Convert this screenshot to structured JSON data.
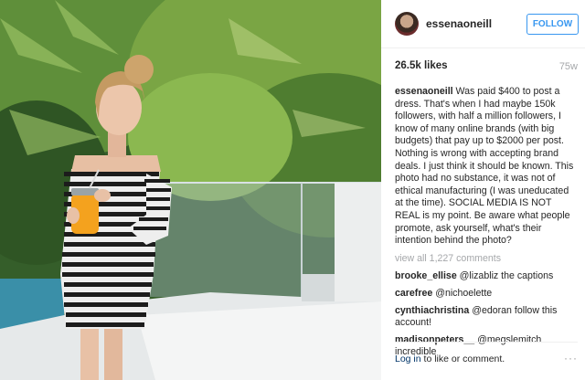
{
  "post": {
    "username": "essenaoneill",
    "follow_label": "FOLLOW",
    "likes": "26.5k likes",
    "age": "75w",
    "caption_user": "essenaoneill",
    "caption_text": "Was paid $400 to post a dress. That's when I had maybe 150k followers, with half a million followers, I know of many online brands (with big budgets) that pay up to $2000 per post. Nothing is wrong with accepting brand deals. I just think it should be known. This photo had no substance, it was not of ethical manufacturing (I was uneducated at the time). SOCIAL MEDIA IS NOT REAL is my point. Be aware what people promote, ask yourself, what's their intention behind the photo?",
    "view_all": "view all 1,227 comments",
    "comments": [
      {
        "user": "brooke_ellise",
        "text": "@lizabliz the captions"
      },
      {
        "user": "carefree",
        "text": "@nichoelette"
      },
      {
        "user": "cynthiachristina",
        "text": "@edoran follow this account!"
      },
      {
        "user": "madisonpeters__",
        "text": "@megslemitch incredible"
      }
    ],
    "login_link": "Log in",
    "login_rest": " to like or comment.",
    "more_icon": "···"
  }
}
